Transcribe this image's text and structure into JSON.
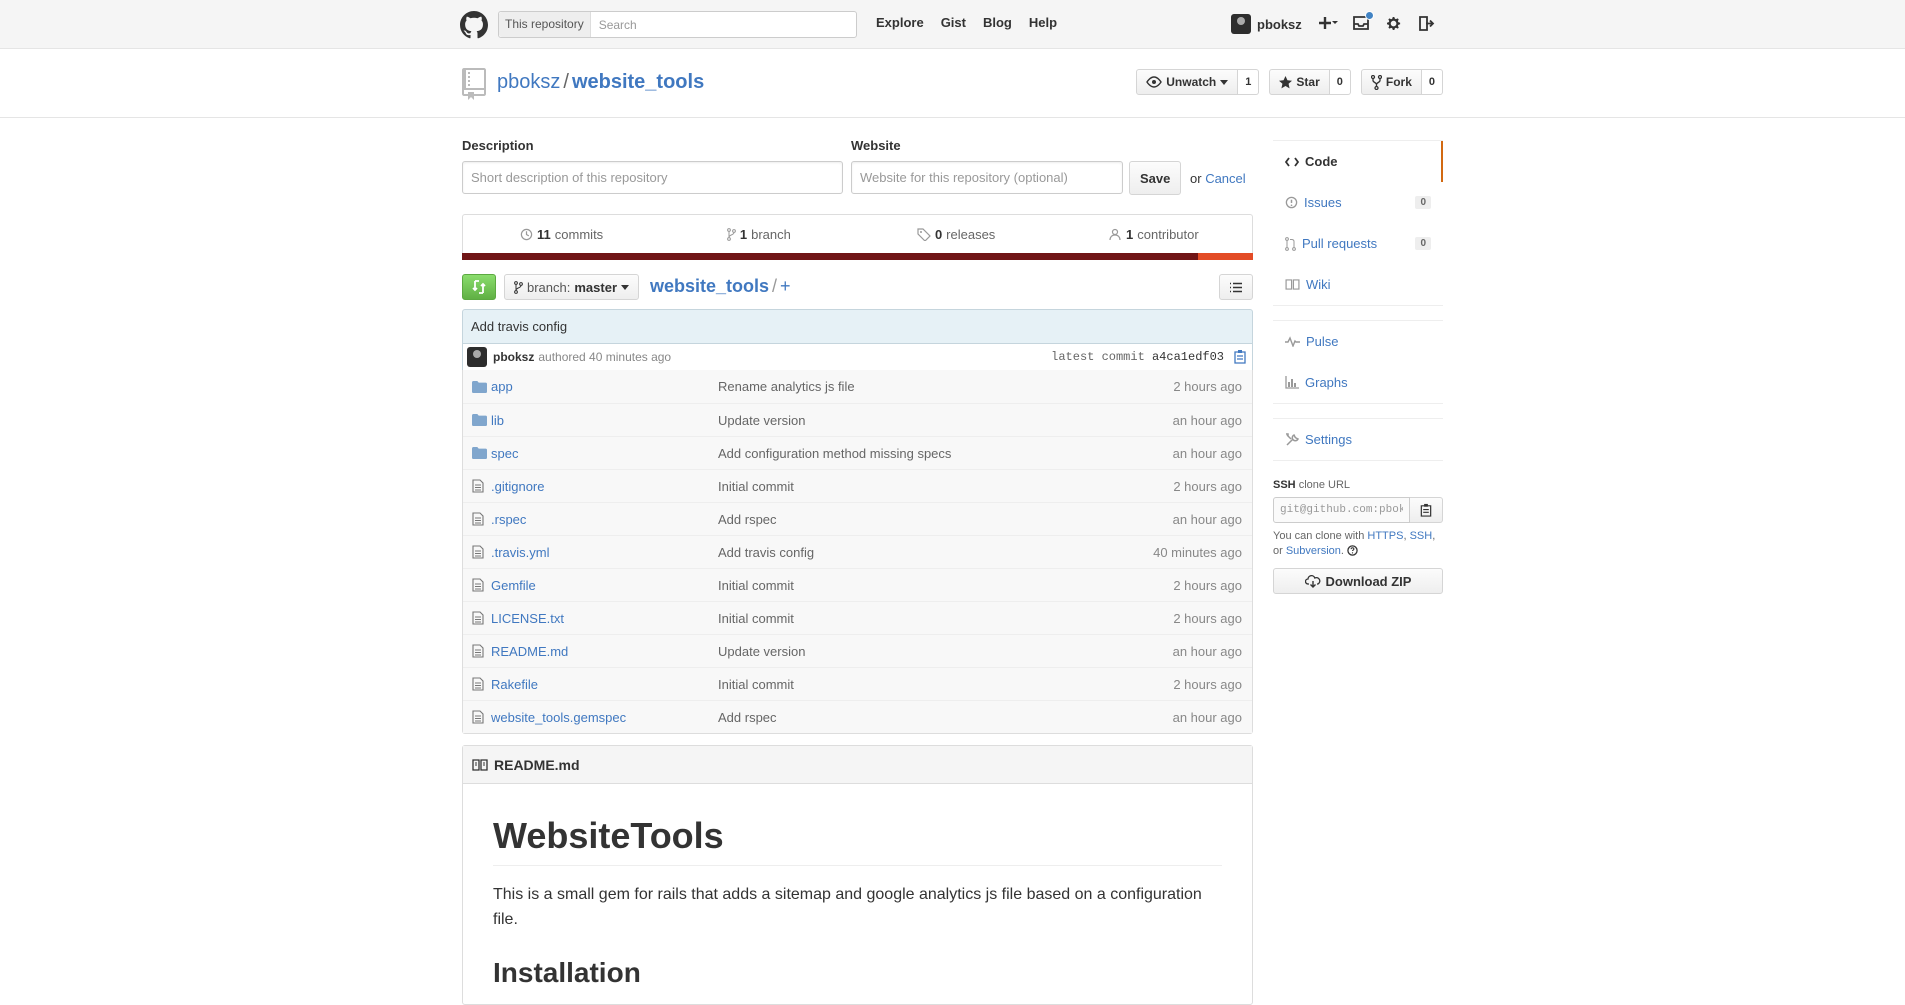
{
  "header": {
    "search_scope": "This repository",
    "search_placeholder": "Search",
    "nav": [
      "Explore",
      "Gist",
      "Blog",
      "Help"
    ],
    "username": "pboksz"
  },
  "repo": {
    "owner": "pboksz",
    "separator": "/",
    "name": "website_tools",
    "unwatch_label": "Unwatch",
    "watch_count": "1",
    "star_label": "Star",
    "star_count": "0",
    "fork_label": "Fork",
    "fork_count": "0"
  },
  "edit": {
    "description_label": "Description",
    "description_placeholder": "Short description of this repository",
    "website_label": "Website",
    "website_placeholder": "Website for this repository (optional)",
    "save_label": "Save",
    "or_text": "or",
    "cancel_label": "Cancel"
  },
  "numbers": {
    "commits_count": "11",
    "commits_label": "commits",
    "branch_count": "1",
    "branch_label": "branch",
    "releases_count": "0",
    "releases_label": "releases",
    "contributor_count": "1",
    "contributor_label": "contributor"
  },
  "language_colors": [
    "#701516",
    "#e34c26"
  ],
  "language_share": [
    0.93,
    0.07
  ],
  "filenav": {
    "branch_prefix": "branch:",
    "branch_name": "master",
    "breadcrumb_repo": "website_tools",
    "breadcrumb_slash": "/",
    "breadcrumb_add": "+"
  },
  "commit": {
    "message": "Add travis config",
    "author": "pboksz",
    "authored_text": "authored 40 minutes ago",
    "latest_label": "latest commit",
    "sha": "a4ca1edf03"
  },
  "files": [
    {
      "type": "dir",
      "name": "app",
      "message": "Rename analytics js file",
      "age": "2 hours ago"
    },
    {
      "type": "dir",
      "name": "lib",
      "message": "Update version",
      "age": "an hour ago"
    },
    {
      "type": "dir",
      "name": "spec",
      "message": "Add configuration method missing specs",
      "age": "an hour ago"
    },
    {
      "type": "file",
      "name": ".gitignore",
      "message": "Initial commit",
      "age": "2 hours ago"
    },
    {
      "type": "file",
      "name": ".rspec",
      "message": "Add rspec",
      "age": "an hour ago"
    },
    {
      "type": "file",
      "name": ".travis.yml",
      "message": "Add travis config",
      "age": "40 minutes ago"
    },
    {
      "type": "file",
      "name": "Gemfile",
      "message": "Initial commit",
      "age": "2 hours ago"
    },
    {
      "type": "file",
      "name": "LICENSE.txt",
      "message": "Initial commit",
      "age": "2 hours ago"
    },
    {
      "type": "file",
      "name": "README.md",
      "message": "Update version",
      "age": "an hour ago"
    },
    {
      "type": "file",
      "name": "Rakefile",
      "message": "Initial commit",
      "age": "2 hours ago"
    },
    {
      "type": "file",
      "name": "website_tools.gemspec",
      "message": "Add rspec",
      "age": "an hour ago"
    }
  ],
  "readme": {
    "filename": "README.md",
    "title": "WebsiteTools",
    "intro": "This is a small gem for rails that adds a sitemap and google analytics js file based on a configuration file.",
    "section": "Installation"
  },
  "sidebar": {
    "code": "Code",
    "issues": "Issues",
    "issues_count": "0",
    "pulls": "Pull requests",
    "pulls_count": "0",
    "wiki": "Wiki",
    "pulse": "Pulse",
    "graphs": "Graphs",
    "settings": "Settings",
    "clone_protocol": "SSH",
    "clone_suffix": "clone URL",
    "clone_url": "git@github.com:pboksz/website_tools.git",
    "clone_help_prefix": "You can clone with",
    "clone_https": "HTTPS",
    "clone_ssh": "SSH",
    "clone_or": "or",
    "clone_subversion": "Subversion",
    "download_zip": "Download ZIP"
  },
  "colors": {
    "link": "#4078c0",
    "selected_tab_accent": "#d26911",
    "green_button": "#60b044"
  }
}
